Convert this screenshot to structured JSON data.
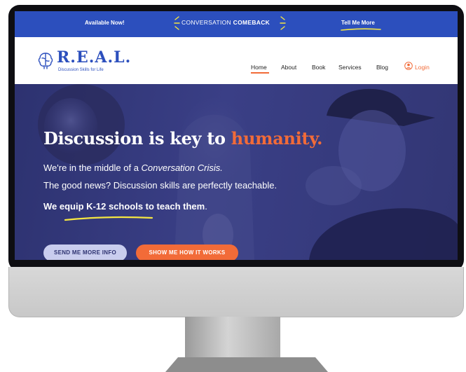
{
  "topbar": {
    "available": "Available Now!",
    "promo_prefix": "CONVERSATION ",
    "promo_bold": "COMEBACK",
    "tell_me_more": "Tell Me More"
  },
  "logo": {
    "name": "R.E.A.L.",
    "tagline": "Discussion Skills for Life"
  },
  "nav": {
    "home": "Home",
    "about": "About",
    "book": "Book",
    "services": "Services",
    "blog": "Blog",
    "login": "Login"
  },
  "hero": {
    "title_main": "Discussion is key to ",
    "title_accent": "humanity.",
    "line1_prefix": "We're in the middle of a ",
    "line1_italic": "Conversation Crisis.",
    "line2": "The good news? Discussion skills are perfectly teachable.",
    "line3_bold": "We equip K-12 schools to teach them",
    "line3_suffix": "."
  },
  "buttons": {
    "send_info": "SEND ME MORE INFO",
    "show_works": "SHOW ME HOW IT WORKS"
  },
  "colors": {
    "brand_blue": "#2c4fbd",
    "accent_orange": "#f26b38",
    "hero_navy": "#2d3270",
    "highlight_yellow": "#f5e642"
  },
  "icons": {
    "logo": "brain-icon",
    "login": "user-icon",
    "promo": "sparkle-icon"
  }
}
